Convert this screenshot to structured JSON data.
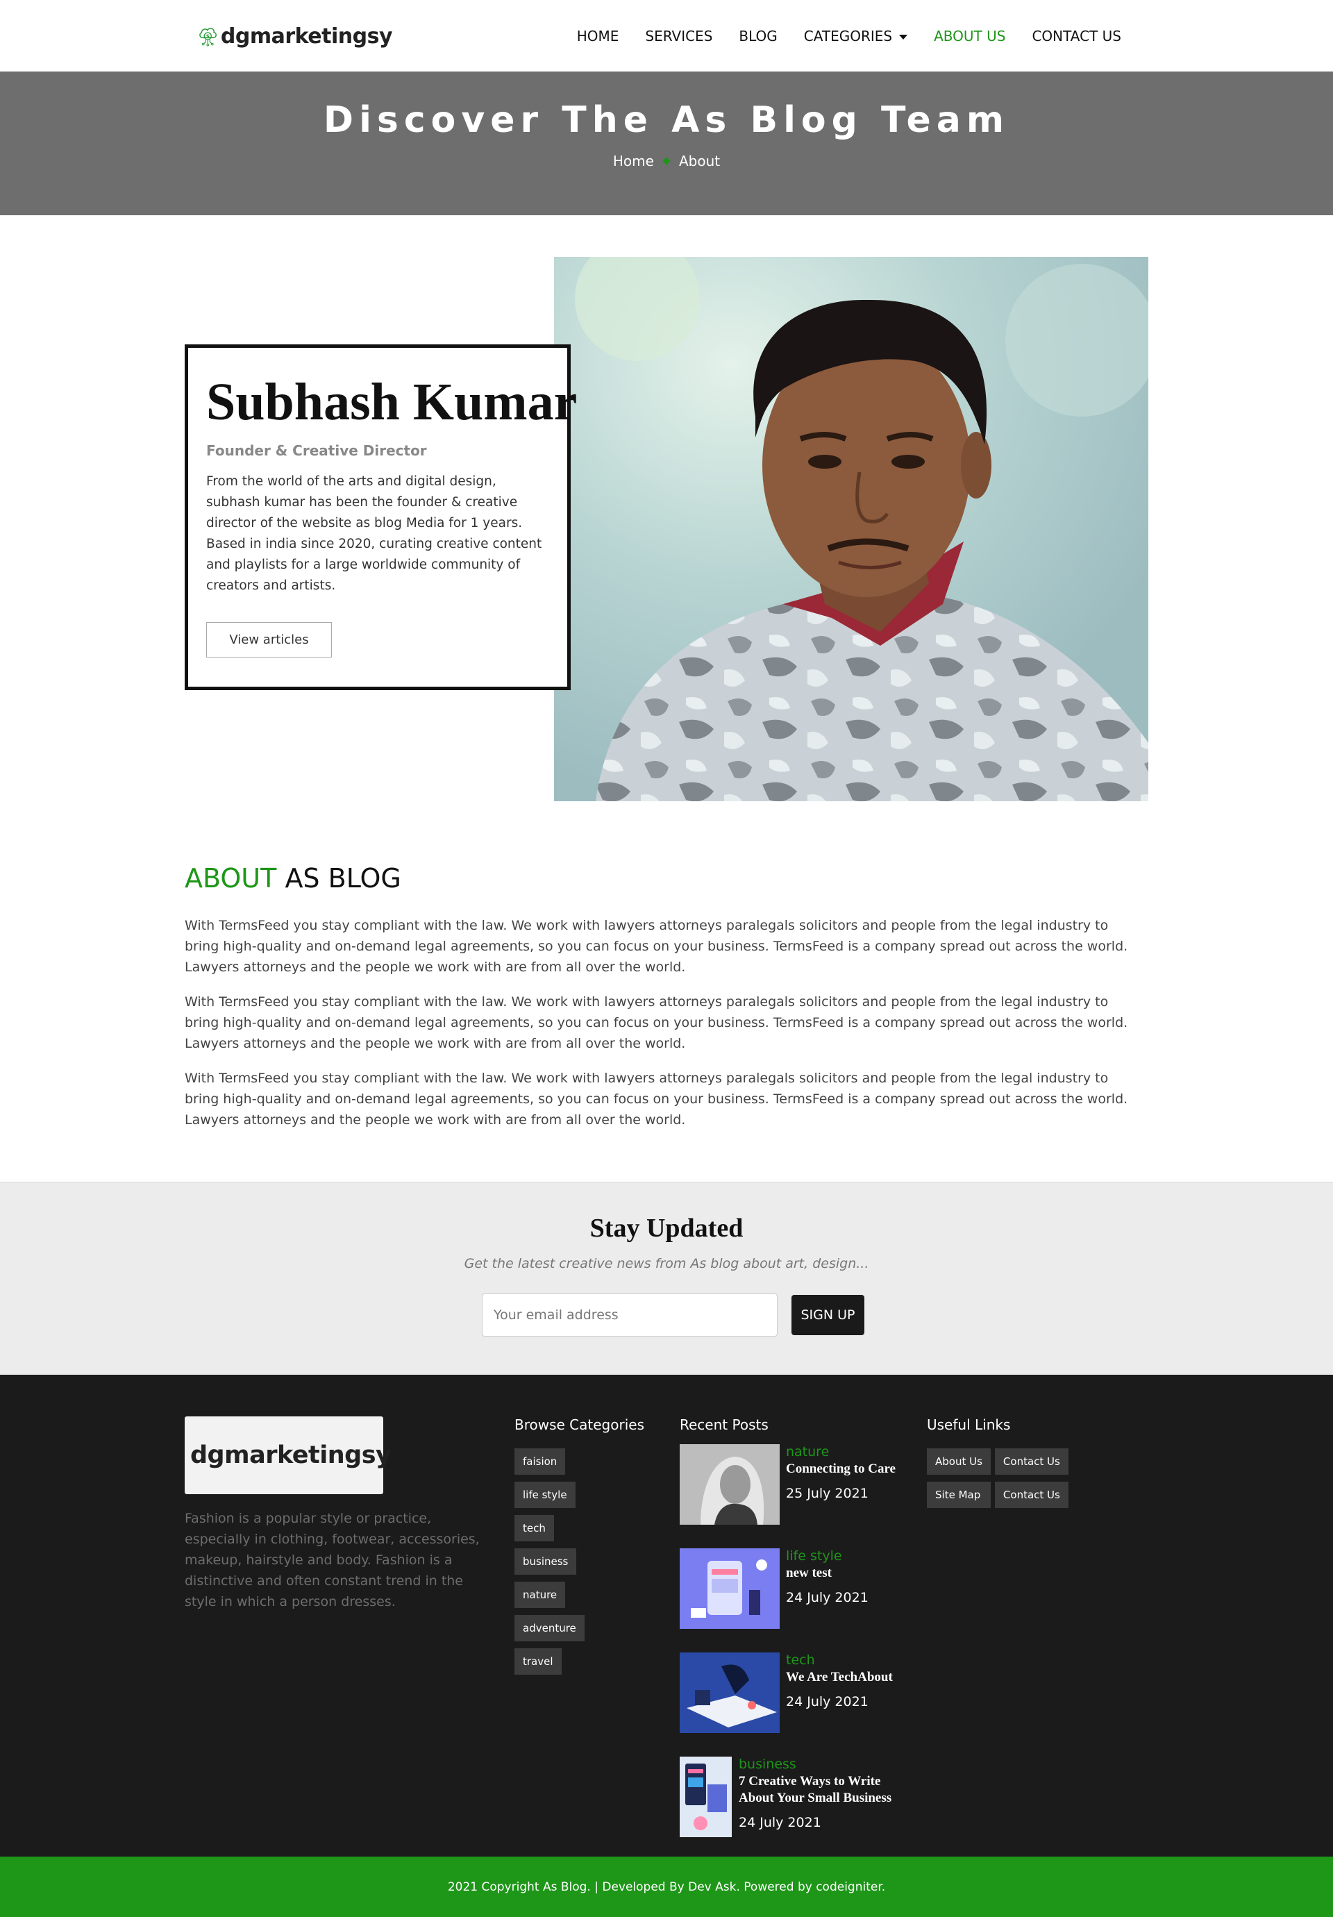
{
  "brand": {
    "name": "dgmarketingsy"
  },
  "nav": {
    "items": [
      {
        "label": "HOME"
      },
      {
        "label": "SERVICES"
      },
      {
        "label": "BLOG"
      },
      {
        "label": "CATEGORIES"
      },
      {
        "label": "ABOUT US"
      },
      {
        "label": "CONTACT US"
      }
    ]
  },
  "hero": {
    "title": "Discover The As Blog Team",
    "breadcrumb": [
      "Home",
      "About"
    ]
  },
  "profile": {
    "name": "Subhash Kumar",
    "role": "Founder & Creative Director",
    "bio": "From the world of the arts and digital design, subhash kumar has been the founder & creative director of the website as blog Media for 1 years. Based in india since 2020, curating creative content and playlists for a large worldwide community of creators and artists.",
    "button": "View articles"
  },
  "about": {
    "title_accent": "ABOUT",
    "title_rest": "AS BLOG",
    "paragraphs": [
      "With TermsFeed you stay compliant with the law. We work with lawyers attorneys paralegals solicitors and people from the legal industry to bring high-quality and on-demand legal agreements, so you can focus on your business. TermsFeed is a company spread out across the world. Lawyers attorneys and the people we work with are from all over the world.",
      "With TermsFeed you stay compliant with the law. We work with lawyers attorneys paralegals solicitors and people from the legal industry to bring high-quality and on-demand legal agreements, so you can focus on your business. TermsFeed is a company spread out across the world. Lawyers attorneys and the people we work with are from all over the world.",
      "With TermsFeed you stay compliant with the law. We work with lawyers attorneys paralegals solicitors and people from the legal industry to bring high-quality and on-demand legal agreements, so you can focus on your business. TermsFeed is a company spread out across the world. Lawyers attorneys and the people we work with are from all over the world."
    ]
  },
  "newsletter": {
    "title": "Stay Updated",
    "subtitle": "Get the latest creative news from As blog about art, design...",
    "placeholder": "Your email address",
    "button": "SIGN UP"
  },
  "footer": {
    "description": "Fashion is a popular style or practice, especially in clothing, footwear, accessories, makeup, hairstyle and body. Fashion is a distinctive and often constant trend in the style in which a person dresses.",
    "categories_heading": "Browse Categories",
    "categories": [
      "faision",
      "life style",
      "tech",
      "business",
      "nature",
      "adventure",
      "travel"
    ],
    "posts_heading": "Recent Posts",
    "posts": [
      {
        "category": "nature",
        "title": "Connecting to Care",
        "date": "25 July 2021"
      },
      {
        "category": "life style",
        "title": "new test",
        "date": "24 July 2021"
      },
      {
        "category": "tech",
        "title": "We Are TechAbout",
        "date": "24 July 2021"
      },
      {
        "category": "business",
        "title": "7 Creative Ways to Write About Your Small Business",
        "date": "24 July 2021"
      }
    ],
    "links_heading": "Useful Links",
    "links": [
      "About Us",
      "Contact Us",
      "Site Map",
      "Contact Us"
    ]
  },
  "copyright": "2021 Copyright As Blog. | Developed By Dev Ask. Powered by codeigniter.",
  "colors": {
    "accent": "#1e9618",
    "footer_bg": "#1b1b1c",
    "hero_bg": "#6e6e6e"
  }
}
